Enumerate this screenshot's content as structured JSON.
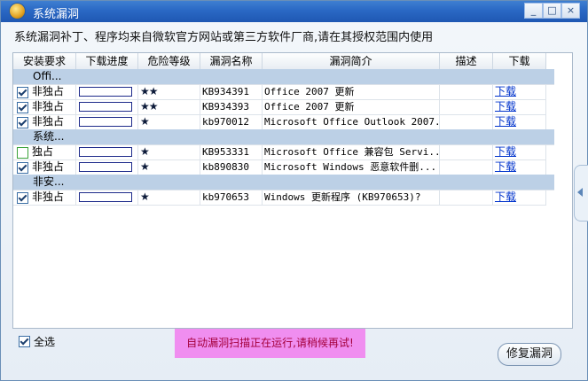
{
  "window": {
    "title": "系统漏洞",
    "min": "_",
    "max": "□",
    "close": "×"
  },
  "notice": "系统漏洞补丁、程序均来自微软官方网站或第三方软件厂商,请在其授权范围内使用",
  "columns": [
    "安装要求",
    "下载进度",
    "危险等级",
    "漏洞名称",
    "漏洞简介",
    "描述",
    "下载"
  ],
  "rows": [
    {
      "kind": "group",
      "label": "Offi..."
    },
    {
      "kind": "item",
      "checked": true,
      "req": "非独占",
      "progress": 0,
      "risk": "★★",
      "name": "KB934391",
      "intro": "Office 2007 更新",
      "desc": "",
      "dl": "下载"
    },
    {
      "kind": "item",
      "checked": true,
      "req": "非独占",
      "progress": 0,
      "risk": "★★",
      "name": "KB934393",
      "intro": "Office 2007 更新",
      "desc": "",
      "dl": "下载"
    },
    {
      "kind": "item",
      "checked": true,
      "req": "非独占",
      "progress": 0,
      "risk": "★",
      "name": "kb970012",
      "intro": "Microsoft Office Outlook 2007...",
      "desc": "",
      "dl": "下载"
    },
    {
      "kind": "group",
      "label": "系统..."
    },
    {
      "kind": "item",
      "checked": false,
      "req": "独占",
      "progress": 0,
      "risk": "★",
      "name": "KB953331",
      "intro": "Microsoft Office 兼容包 Servi...",
      "desc": "",
      "dl": "下载"
    },
    {
      "kind": "item",
      "checked": true,
      "req": "非独占",
      "progress": 0,
      "risk": "★",
      "name": "kb890830",
      "intro": "Microsoft Windows 恶意软件删...",
      "desc": "",
      "dl": "下载"
    },
    {
      "kind": "group",
      "label": "非安..."
    },
    {
      "kind": "item",
      "checked": true,
      "req": "非独占",
      "progress": 0,
      "risk": "★",
      "name": "kb970653",
      "intro": "Windows 更新程序 (KB970653)?",
      "desc": "",
      "dl": "下载"
    }
  ],
  "select_all": {
    "label": "全选",
    "checked": true
  },
  "status": "自动漏洞扫描正在运行,请稍候再试!",
  "fix_button": "修复漏洞"
}
